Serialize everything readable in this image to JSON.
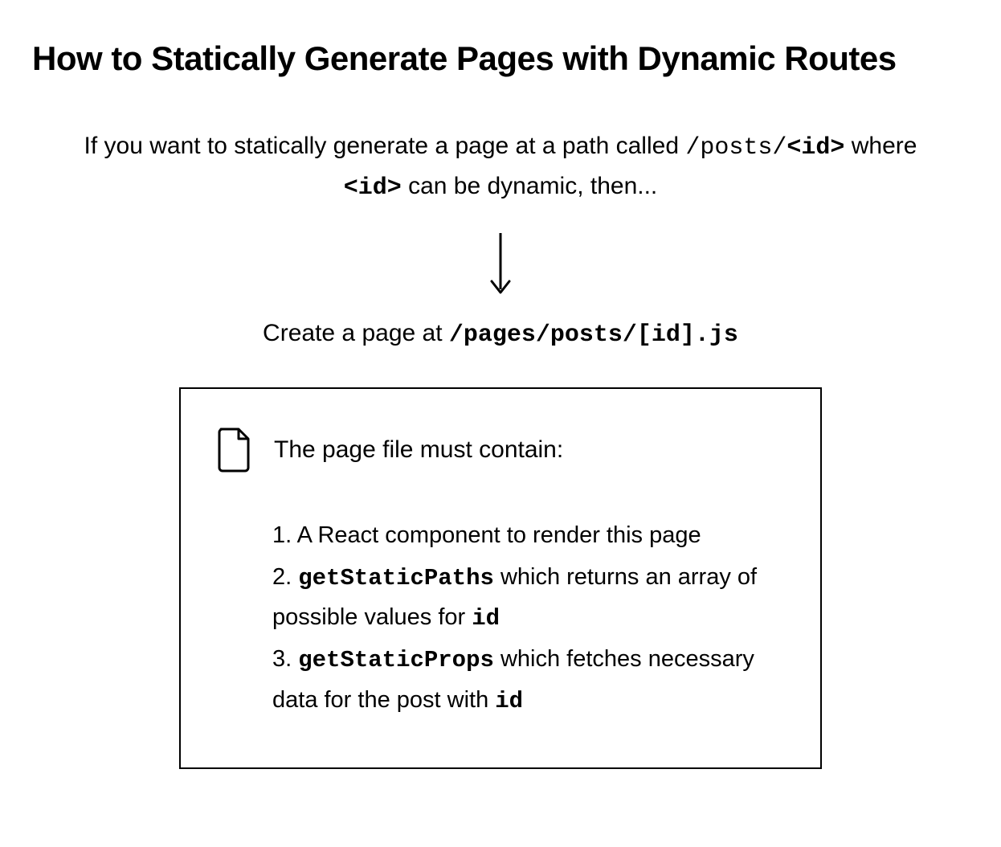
{
  "title": "How to Statically Generate Pages with Dynamic Routes",
  "intro": {
    "prefix": "If you want to statically generate a page at a path called ",
    "path_code": "/posts/",
    "id_code": "<id>",
    "mid": " where ",
    "id_code2": "<id>",
    "suffix": " can be dynamic, then..."
  },
  "create": {
    "prefix": "Create a page at ",
    "path": "/pages/posts/[id].js"
  },
  "box": {
    "title": "The page file must contain:",
    "items": [
      {
        "num": "1.",
        "parts": [
          {
            "text": " A React component to render this page",
            "mono": false,
            "bold": false
          }
        ]
      },
      {
        "num": "2.",
        "parts": [
          {
            "text": " ",
            "mono": false,
            "bold": false
          },
          {
            "text": "getStaticPaths",
            "mono": true,
            "bold": true
          },
          {
            "text": " which returns an array of possible values for ",
            "mono": false,
            "bold": false
          },
          {
            "text": "id",
            "mono": true,
            "bold": true
          }
        ]
      },
      {
        "num": "3.",
        "parts": [
          {
            "text": " ",
            "mono": false,
            "bold": false
          },
          {
            "text": "getStaticProps",
            "mono": true,
            "bold": true
          },
          {
            "text": " which fetches necessary data for the post with ",
            "mono": false,
            "bold": false
          },
          {
            "text": "id",
            "mono": true,
            "bold": true
          }
        ]
      }
    ]
  }
}
